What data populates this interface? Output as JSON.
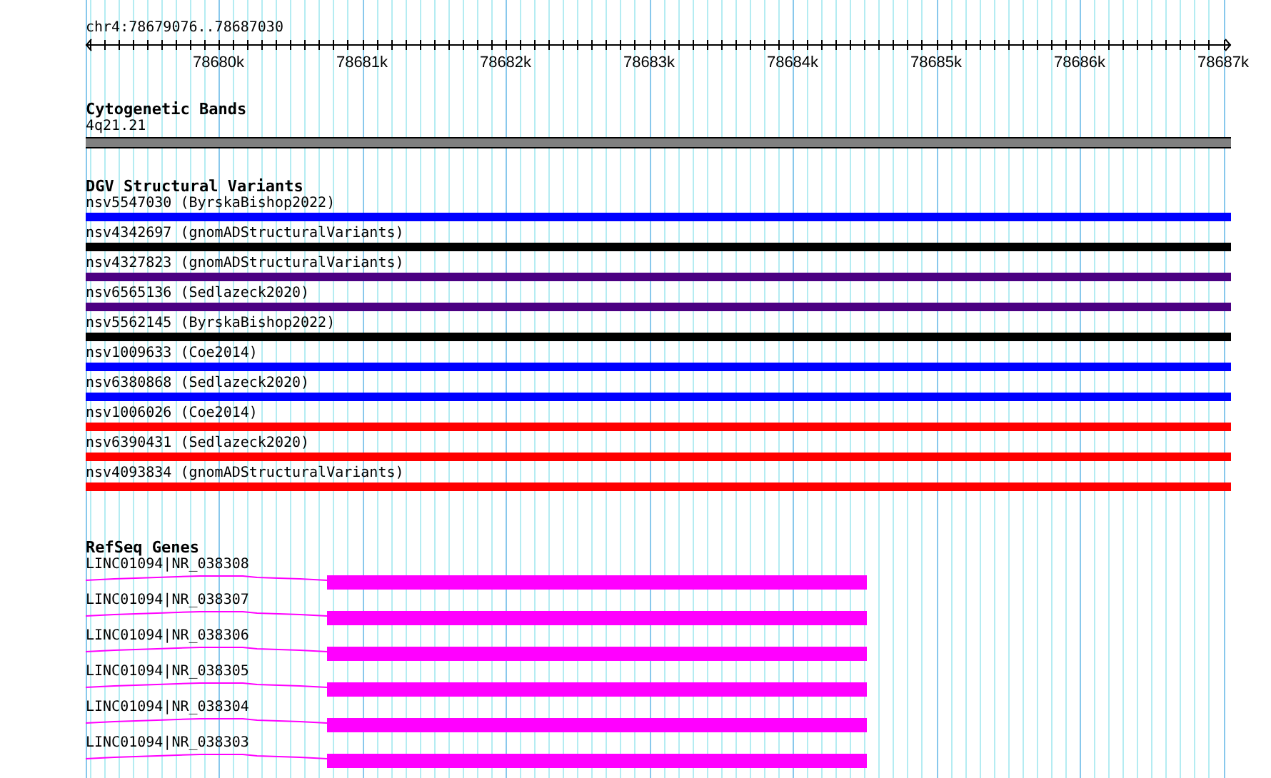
{
  "ruler": {
    "location": "chr4:78679076..78687030",
    "ticks": [
      "78680k",
      "78681k",
      "78682k",
      "78683k",
      "78684k",
      "78685k",
      "78686k",
      "78687k"
    ]
  },
  "tracks": [
    {
      "kind": "band",
      "title": "Cytogenetic Bands",
      "features": [
        {
          "label": "4q21.21",
          "color": "#808080"
        }
      ]
    },
    {
      "kind": "variant",
      "title": "DGV Structural Variants",
      "features": [
        {
          "label": "nsv5547030 (ByrskaBishop2022)",
          "color": "#0000ff"
        },
        {
          "label": "nsv4342697 (gnomADStructuralVariants)",
          "color": "#000000"
        },
        {
          "label": "nsv4327823 (gnomADStructuralVariants)",
          "color": "#4b0082"
        },
        {
          "label": "nsv6565136 (Sedlazeck2020)",
          "color": "#4b0082"
        },
        {
          "label": "nsv5562145 (ByrskaBishop2022)",
          "color": "#000000"
        },
        {
          "label": "nsv1009633 (Coe2014)",
          "color": "#0000ff"
        },
        {
          "label": "nsv6380868 (Sedlazeck2020)",
          "color": "#0000ff"
        },
        {
          "label": "nsv1006026 (Coe2014)",
          "color": "#ff0000"
        },
        {
          "label": "nsv6390431 (Sedlazeck2020)",
          "color": "#ff0000"
        },
        {
          "label": "nsv4093834 (gnomADStructuralVariants)",
          "color": "#ff0000"
        }
      ]
    },
    {
      "kind": "gene",
      "title": "RefSeq Genes",
      "features": [
        {
          "label": "LINC01094|NR_038308",
          "color": "#ff00ff"
        },
        {
          "label": "LINC01094|NR_038307",
          "color": "#ff00ff"
        },
        {
          "label": "LINC01094|NR_038306",
          "color": "#ff00ff"
        },
        {
          "label": "LINC01094|NR_038305",
          "color": "#ff00ff"
        },
        {
          "label": "LINC01094|NR_038304",
          "color": "#ff00ff"
        },
        {
          "label": "LINC01094|NR_038303",
          "color": "#ff00ff"
        }
      ]
    }
  ]
}
